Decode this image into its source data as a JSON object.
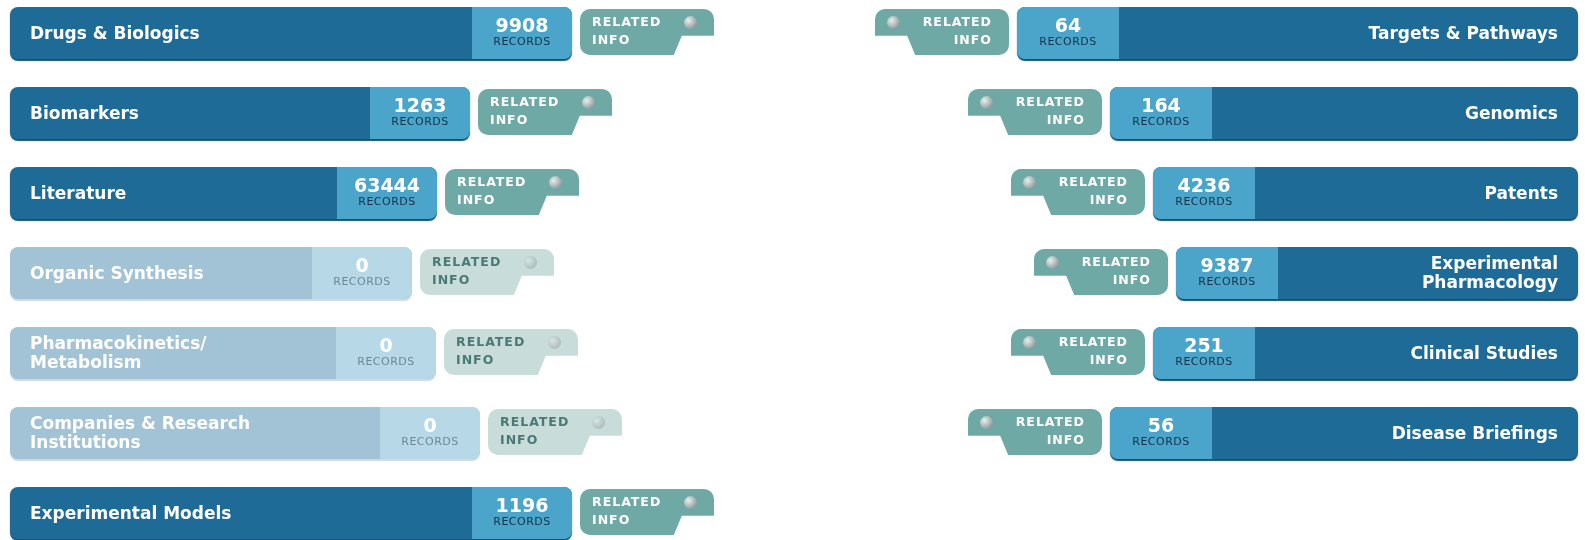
{
  "left_column": {
    "rows": [
      {
        "label": "Drugs & Biologics",
        "count": "9908",
        "unit": "RECORDS",
        "related": "RELATED INFO",
        "disabled": false
      },
      {
        "label": "Biomarkers",
        "count": "1263",
        "unit": "RECORDS",
        "related": "RELATED INFO",
        "disabled": false
      },
      {
        "label": "Literature",
        "count": "63444",
        "unit": "RECORDS",
        "related": "RELATED INFO",
        "disabled": false
      },
      {
        "label": "Organic Synthesis",
        "count": "0",
        "unit": "RECORDS",
        "related": "RELATED INFO",
        "disabled": true
      },
      {
        "label": "Pharmacokinetics/ Metabolism",
        "count": "0",
        "unit": "RECORDS",
        "related": "RELATED INFO",
        "disabled": true
      },
      {
        "label": "Companies & Research Institutions",
        "count": "0",
        "unit": "RECORDS",
        "related": "RELATED INFO",
        "disabled": true
      },
      {
        "label": "Experimental Models",
        "count": "1196",
        "unit": "RECORDS",
        "related": "RELATED INFO",
        "disabled": false
      }
    ]
  },
  "right_column": {
    "rows": [
      {
        "label": "Targets & Pathways",
        "count": "64",
        "unit": "RECORDS",
        "related": "RELATED INFO",
        "disabled": false
      },
      {
        "label": "Genomics",
        "count": "164",
        "unit": "RECORDS",
        "related": "RELATED INFO",
        "disabled": false
      },
      {
        "label": "Patents",
        "count": "4236",
        "unit": "RECORDS",
        "related": "RELATED INFO",
        "disabled": false
      },
      {
        "label": "Experimental Pharmacology",
        "count": "9387",
        "unit": "RECORDS",
        "related": "RELATED INFO",
        "disabled": false
      },
      {
        "label": "Clinical Studies",
        "count": "251",
        "unit": "RECORDS",
        "related": "RELATED INFO",
        "disabled": false
      },
      {
        "label": "Disease Briefings",
        "count": "56",
        "unit": "RECORDS",
        "related": "RELATED INFO",
        "disabled": false
      }
    ]
  }
}
